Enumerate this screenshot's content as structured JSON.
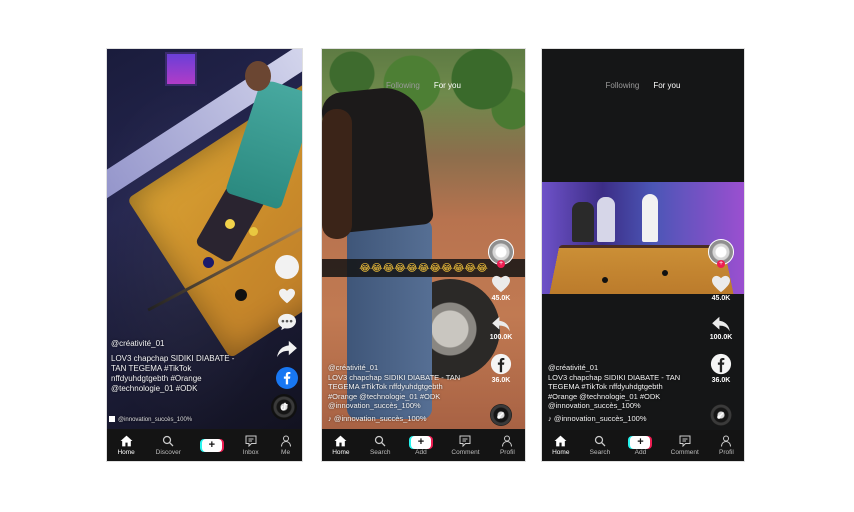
{
  "colors": {
    "like": "#f0f0f0",
    "facebook": "#1877f2",
    "tiktok_red": "#ee1d52",
    "tiktok_cyan": "#26f4ee",
    "nav_bg": "#141414"
  },
  "phones": [
    {
      "caption": {
        "user": "@créativité_01",
        "text_lines": [
          "LOV3 chapchap SIDIKI DIABATE -",
          "TAN TEGEMA #TikTok",
          "nffdyuhdgtgebth #Orange",
          "@technologie_01 #ODK"
        ],
        "music": "@innovation_succès_100%"
      },
      "nav": [
        {
          "label": "Home",
          "icon": "home-icon"
        },
        {
          "label": "Discover",
          "icon": "search-icon"
        },
        {
          "label": "",
          "icon": "plus-icon"
        },
        {
          "label": "Inbox",
          "icon": "message-icon"
        },
        {
          "label": "Me",
          "icon": "profile-icon"
        }
      ]
    },
    {
      "topnav": {
        "following": "Following",
        "for_you": "For you"
      },
      "emoji_strip": "😂😂😂😂😂😂😂😂😂😂😂",
      "actions": {
        "likes": "45.0K",
        "shares": "100.0K",
        "facebook": "36.0K"
      },
      "caption": {
        "user": "@créativité_01",
        "text_lines": [
          "LOV3 chapchap SIDIKI DIABATE - TAN",
          "TEGEMA #TikTok nffdyuhdgtgebth",
          "#Orange @technologie_01 #ODK",
          "@innovation_succès_100%"
        ],
        "music": "@innovation_succès_100%"
      },
      "nav": [
        {
          "label": "Home",
          "icon": "home-icon"
        },
        {
          "label": "Search",
          "icon": "search-icon"
        },
        {
          "label": "Add",
          "icon": "plus-icon"
        },
        {
          "label": "Comment",
          "icon": "message-icon"
        },
        {
          "label": "Profil",
          "icon": "profile-icon"
        }
      ]
    },
    {
      "topnav": {
        "following": "Following",
        "for_you": "For you"
      },
      "actions": {
        "likes": "45.0K",
        "shares": "100.0K",
        "facebook": "36.0K"
      },
      "caption": {
        "user": "@créativité_01",
        "text_lines": [
          "LOV3 chapchap SIDIKI DIABATE - TAN",
          "TEGEMA #TikTok nffdyuhdgtgebth",
          "#Orange @technologie_01 #ODK",
          "@innovation_succès_100%"
        ],
        "music": "@innovation_succès_100%"
      },
      "nav": [
        {
          "label": "Home",
          "icon": "home-icon"
        },
        {
          "label": "Search",
          "icon": "search-icon"
        },
        {
          "label": "Add",
          "icon": "plus-icon"
        },
        {
          "label": "Comment",
          "icon": "message-icon"
        },
        {
          "label": "Profil",
          "icon": "profile-icon"
        }
      ]
    }
  ]
}
